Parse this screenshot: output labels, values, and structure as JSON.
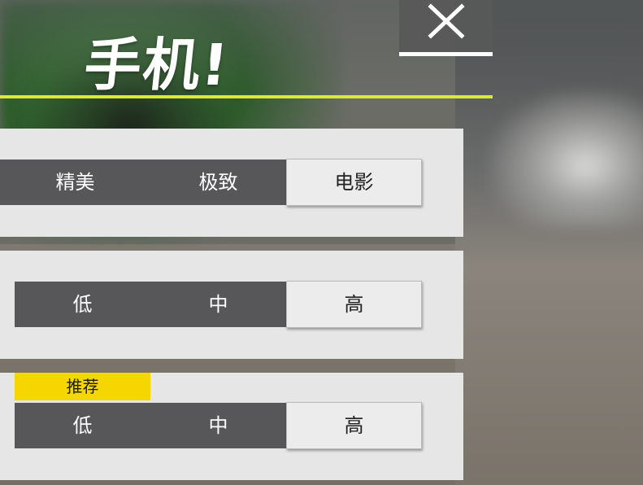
{
  "title": "手机!",
  "colors": {
    "accent_line": "#d9e93a",
    "badge": "#f5d600",
    "segment_dark": "#575759",
    "segment_selected": "#ececec",
    "panel": "#e7e6e6"
  },
  "close_button": {
    "icon": "close-icon"
  },
  "settings": [
    {
      "options": [
        "精美",
        "极致",
        "电影"
      ],
      "selected": "电影"
    },
    {
      "options": [
        "低",
        "中",
        "高"
      ],
      "selected": "高"
    },
    {
      "badge": "推荐",
      "options": [
        "低",
        "中",
        "高"
      ],
      "selected": "高"
    }
  ]
}
